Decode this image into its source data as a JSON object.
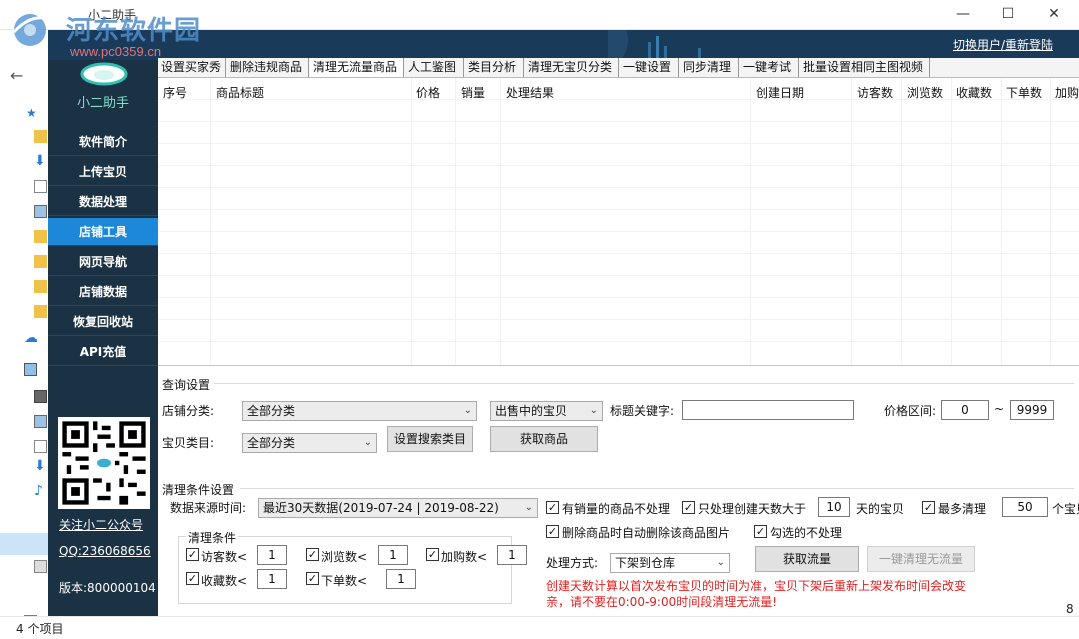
{
  "watermark": {
    "title": "河东软件园",
    "url": "www.pc0359.cn"
  },
  "window": {
    "title": "小二助手",
    "min": "—",
    "max": "☐",
    "close": "✕"
  },
  "header": {
    "switch_user": "切换用户/重新登陆"
  },
  "sidebar": {
    "app_name": "小二助手",
    "items": [
      {
        "label": "软件简介"
      },
      {
        "label": "上传宝贝"
      },
      {
        "label": "数据处理"
      },
      {
        "label": "店铺工具"
      },
      {
        "label": "网页导航"
      },
      {
        "label": "店铺数据"
      },
      {
        "label": "恢复回收站"
      },
      {
        "label": "API充值"
      }
    ],
    "follow": "关注小二公众号",
    "qq": "QQ:236068656",
    "version": "版本:800000104"
  },
  "tabs": [
    {
      "label": "设置买家秀"
    },
    {
      "label": "删除违规商品"
    },
    {
      "label": "清理无流量商品"
    },
    {
      "label": "人工鉴图"
    },
    {
      "label": "类目分析"
    },
    {
      "label": "清理无宝贝分类"
    },
    {
      "label": "一键设置"
    },
    {
      "label": "同步清理"
    },
    {
      "label": "一键考试"
    },
    {
      "label": "批量设置相同主图视频"
    }
  ],
  "table": {
    "columns": [
      "序号",
      "商品标题",
      "价格",
      "销量",
      "处理结果",
      "创建日期",
      "访客数",
      "浏览数",
      "收藏数",
      "下单数",
      "加购"
    ]
  },
  "query": {
    "section_title": "查询设置",
    "shop_category_label": "店铺分类:",
    "shop_category_value": "全部分类",
    "status_value": "出售中的宝贝",
    "keyword_label": "标题关键字:",
    "keyword_value": "",
    "price_label": "价格区间:",
    "price_min": "0",
    "price_sep": "~",
    "price_max": "9999",
    "item_category_label": "宝贝类目:",
    "item_category_value": "全部分类",
    "set_category_btn": "设置搜索类目",
    "get_goods_btn": "获取商品"
  },
  "clean": {
    "section_title": "清理条件设置",
    "source_label": "数据来源时间:",
    "source_value": "最近30天数据(2019-07-24 | 2019-08-22)",
    "opt_sales": "有销量的商品不处理",
    "opt_days_prefix": "只处理创建天数大于",
    "opt_days_value": "10",
    "opt_days_suffix": "天的宝贝",
    "opt_max_prefix": "最多清理",
    "opt_max_value": "50",
    "opt_max_suffix": "个宝贝",
    "opt_delete_img": "删除商品时自动删除该商品图片",
    "opt_checked_skip": "勾选的不处理",
    "conditions_title": "清理条件",
    "visitors_label": "访客数<",
    "visitors_value": "1",
    "views_label": "浏览数<",
    "views_value": "1",
    "cart_label": "加购数<",
    "cart_value": "1",
    "favorites_label": "收藏数<",
    "favorites_value": "1",
    "orders_label": "下单数<",
    "orders_value": "1",
    "method_label": "处理方式:",
    "method_value": "下架到仓库",
    "get_traffic_btn": "获取流量",
    "clean_btn": "一键清理无流量",
    "warning_1": "创建天数计算以首次发布宝贝的时间为准，宝贝下架后重新上架发布时间会改变",
    "warning_2": "亲，请不要在0:00-9:00时间段清理无流量!"
  },
  "explorer": {
    "status": "4 个项目"
  },
  "colors": {
    "sidebar": "#1b3245",
    "active_nav": "#1e88d8",
    "header": "#1a3a5a",
    "warning": "#e02020"
  }
}
